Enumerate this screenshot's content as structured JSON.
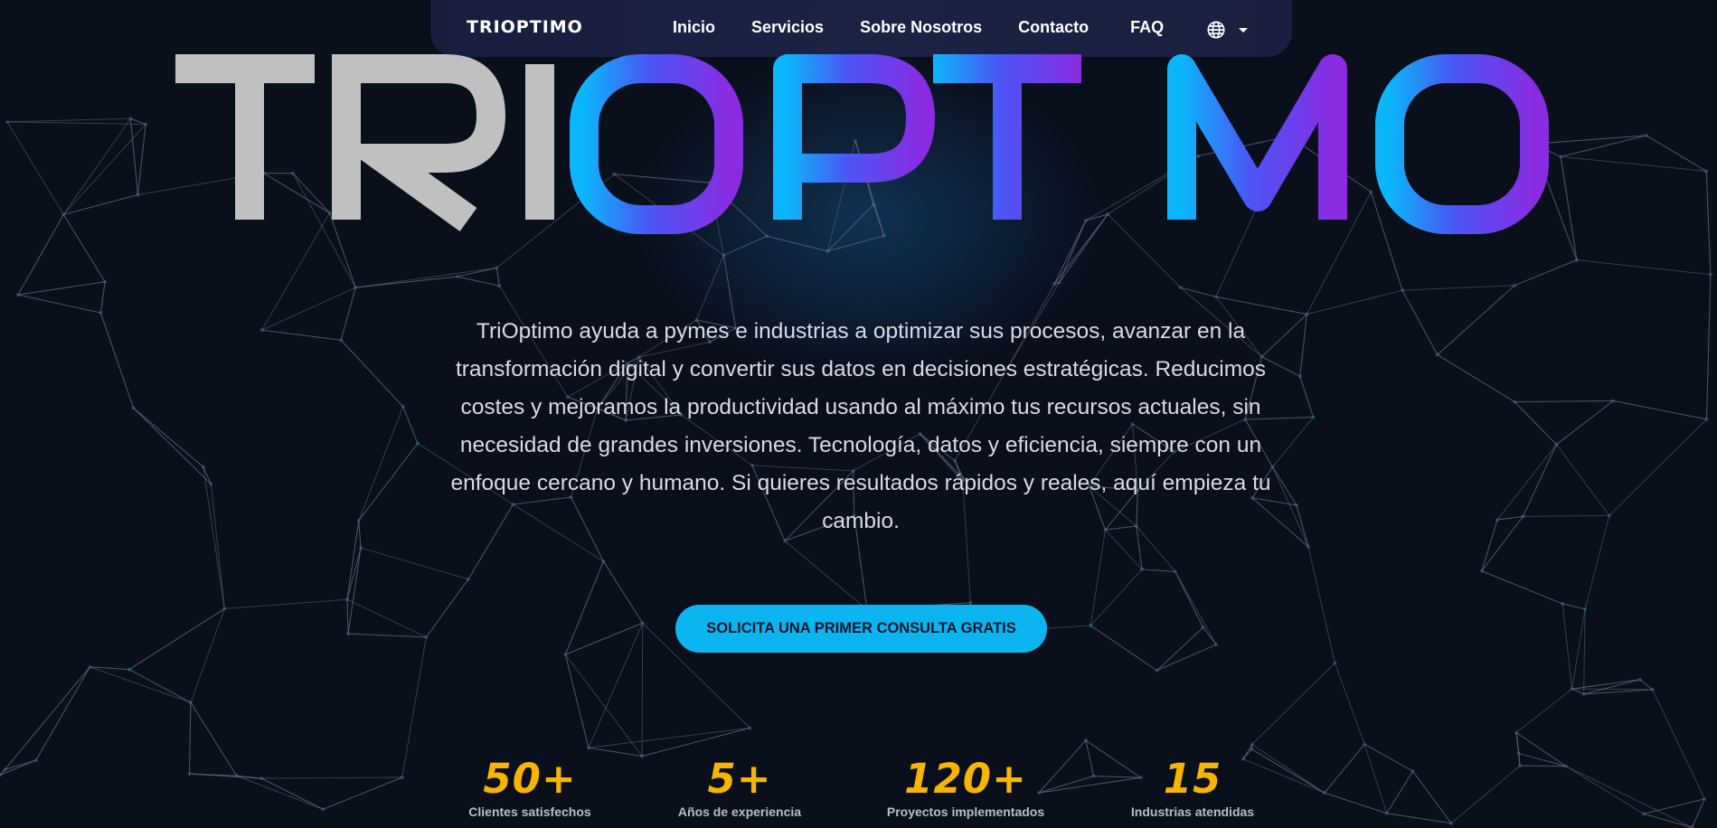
{
  "navbar": {
    "brand": "TRIOPTIMO",
    "links": [
      "Inicio",
      "Servicios",
      "Sobre Nosotros",
      "Contacto",
      "FAQ"
    ],
    "language_icon": "globe-icon",
    "dropdown_icon": "caret-down-icon"
  },
  "hero": {
    "wordmark": "TRIOPTIMO",
    "description": "TriOptimo ayuda a pymes e industrias a optimizar sus procesos, avanzar en la transformación digital y convertir sus datos en decisiones estratégicas. Reducimos costes y mejoramos la productividad usando al máximo tus recursos actuales, sin necesidad de grandes inversiones. Tecnología, datos y eficiencia, siempre con un enfoque cercano y humano. Si quieres resultados rápidos y reales, aquí empieza tu cambio.",
    "cta_label": "SOLICITA UNA PRIMER CONSULTA GRATIS"
  },
  "stats": [
    {
      "value": "50+",
      "label": "Clientes satisfechos"
    },
    {
      "value": "5+",
      "label": "Años de experiencia"
    },
    {
      "value": "120+",
      "label": "Proyectos implementados"
    },
    {
      "value": "15",
      "label": "Industrias atendidas"
    }
  ],
  "colors": {
    "background": "#0a0f1c",
    "navbar": "#1b2244",
    "cta": "#0bb5f0",
    "stat_accent": "#f7b500",
    "wordmark_gray": "#c0c0c0",
    "wordmark_gradient_start": "#0cb6fb",
    "wordmark_gradient_mid": "#4a56f5",
    "wordmark_gradient_end": "#8a2be2"
  }
}
